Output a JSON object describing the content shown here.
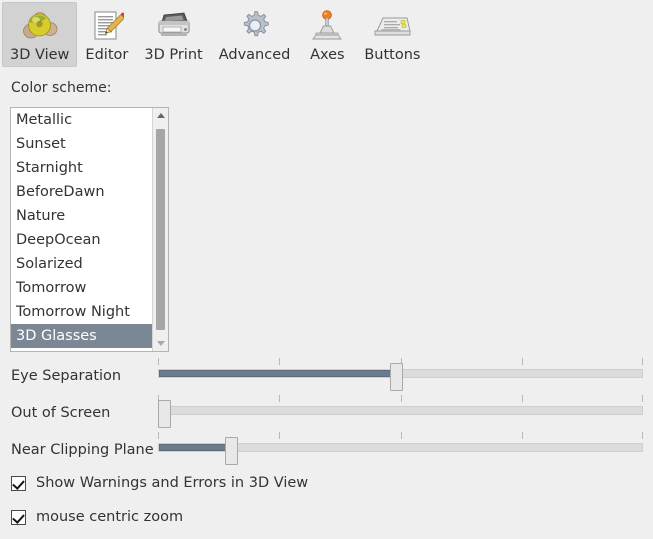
{
  "toolbar": {
    "tabs": [
      {
        "label": "3D View",
        "icon": "spheres-3d-icon",
        "selected": true
      },
      {
        "label": "Editor",
        "icon": "document-pencil-icon",
        "selected": false
      },
      {
        "label": "3D Print",
        "icon": "printer-icon",
        "selected": false
      },
      {
        "label": "Advanced",
        "icon": "gear-icon",
        "selected": false
      },
      {
        "label": "Axes",
        "icon": "joystick-icon",
        "selected": false
      },
      {
        "label": "Buttons",
        "icon": "keyboard-icon",
        "selected": false
      }
    ]
  },
  "color_scheme": {
    "label": "Color scheme:",
    "items": [
      "Metallic",
      "Sunset",
      "Starnight",
      "BeforeDawn",
      "Nature",
      "DeepOcean",
      "Solarized",
      "Tomorrow",
      "Tomorrow Night",
      "3D Glasses"
    ],
    "selected": "3D Glasses",
    "selected_index": 9
  },
  "sliders": [
    {
      "label": "Eye Separation",
      "value_percent": 49,
      "ticks": 5
    },
    {
      "label": "Out of Screen",
      "value_percent": 0,
      "ticks": 5
    },
    {
      "label": "Near Clipping Plane",
      "value_percent": 15,
      "ticks": 5
    }
  ],
  "checkboxes": [
    {
      "label": "Show Warnings and Errors in 3D View",
      "checked": true
    },
    {
      "label": "mouse centric zoom",
      "checked": true
    }
  ],
  "colors": {
    "background": "#efefef",
    "selection": "#7b8794",
    "slider_fill": "#6b7a8d",
    "slider_track": "#dcdcdc",
    "tab_selected": "#d2d2d2"
  }
}
